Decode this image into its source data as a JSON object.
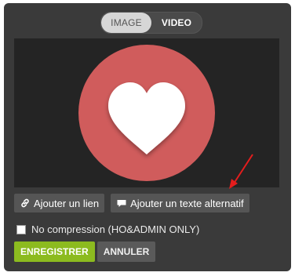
{
  "toggle": {
    "image_label": "IMAGE",
    "video_label": "VIDEO",
    "selected": "IMAGE"
  },
  "toolbar": {
    "add_link_label": "Ajouter un lien",
    "add_alt_label": "Ajouter un texte alternatif"
  },
  "options": {
    "no_compression_label": "No compression (HO&ADMIN ONLY)",
    "no_compression_checked": false
  },
  "actions": {
    "save_label": "ENREGISTRER",
    "cancel_label": "ANNULER"
  },
  "icons": {
    "link": "link-icon",
    "comment": "comment-icon",
    "heart": "heart-icon",
    "annotation_arrow": "red-arrow-icon"
  },
  "colors": {
    "accent_green": "#8cbb1f",
    "heart_circle": "#d05c5c",
    "panel": "#3a3a3a",
    "annotation_arrow": "#e41d1d"
  }
}
